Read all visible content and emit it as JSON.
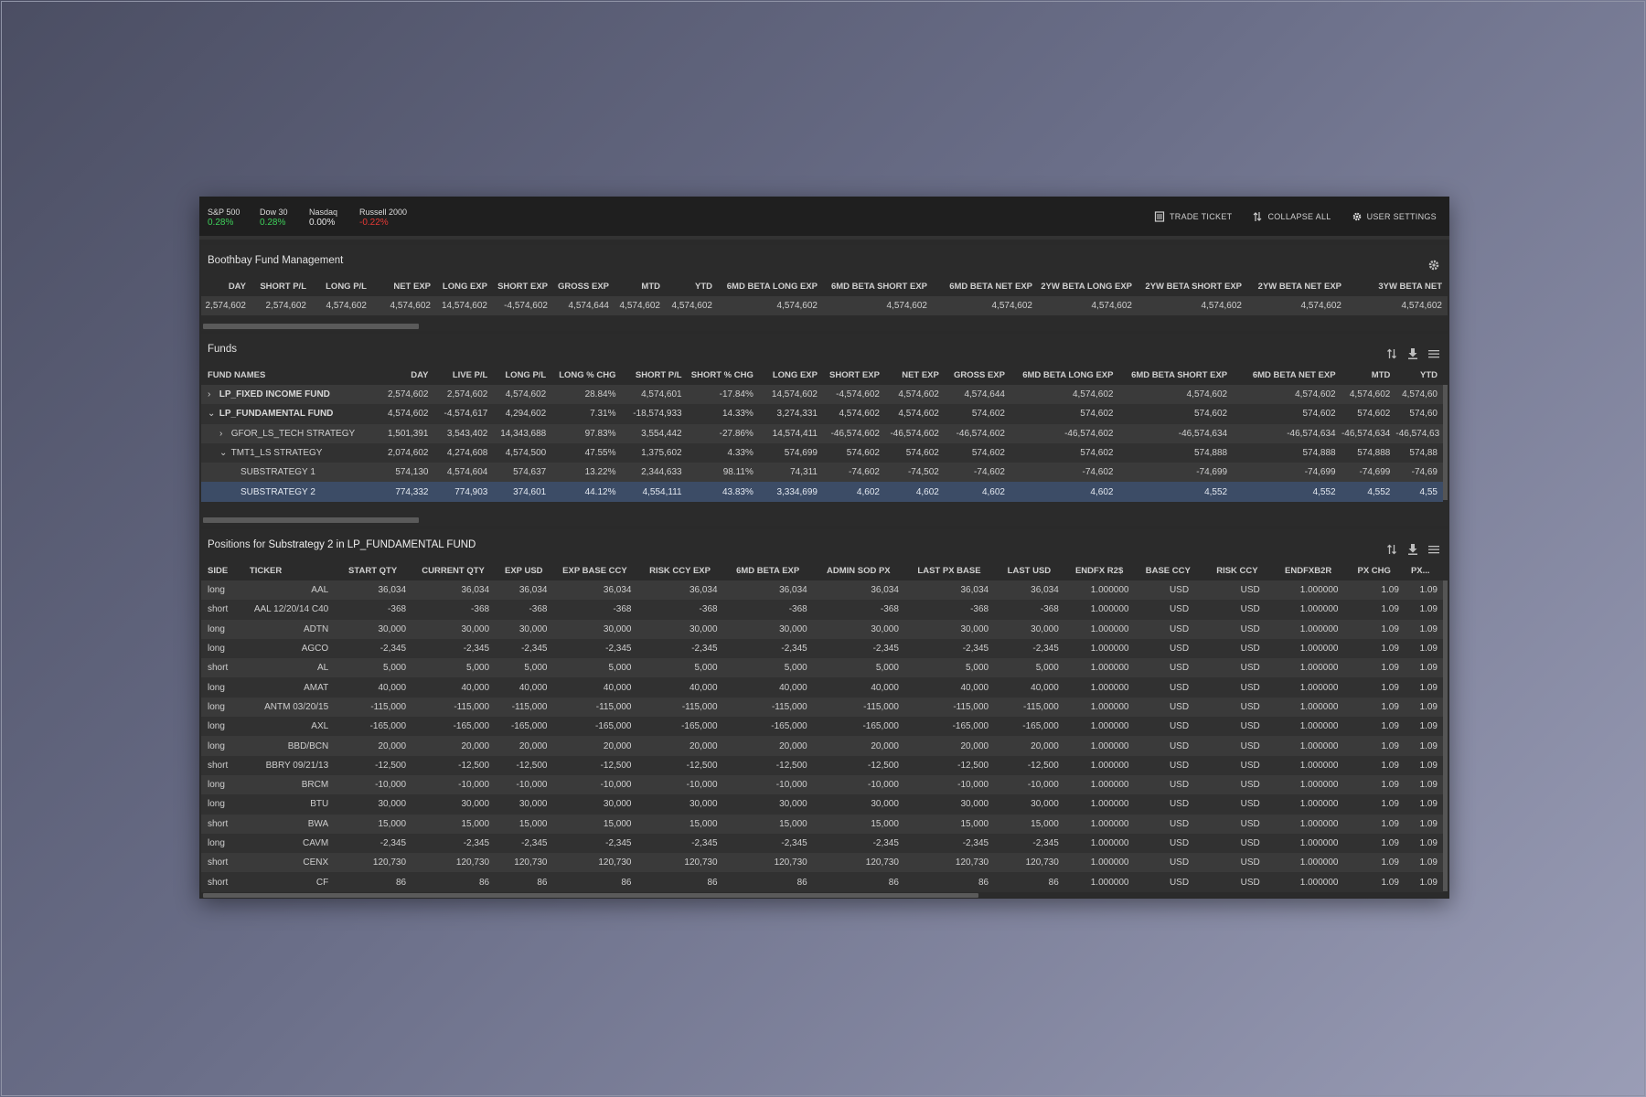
{
  "tickers": [
    {
      "name": "S&P 500",
      "value": "0.28%",
      "tone": "pos"
    },
    {
      "name": "Dow 30",
      "value": "0.28%",
      "tone": "pos"
    },
    {
      "name": "Nasdaq",
      "value": "0.00%",
      "tone": "neu"
    },
    {
      "name": "Russell 2000",
      "value": "-0.22%",
      "tone": "neg"
    }
  ],
  "actions": {
    "trade_ticket": "TRADE TICKET",
    "collapse_all": "COLLAPSE ALL",
    "user_settings": "USER SETTINGS"
  },
  "summary": {
    "title": "Boothbay Fund Management",
    "columns": [
      "DAY",
      "SHORT P/L",
      "LONG P/L",
      "NET EXP",
      "LONG EXP",
      "SHORT EXP",
      "GROSS EXP",
      "MTD",
      "YTD",
      "6MD BETA LONG EXP",
      "6MD BETA SHORT EXP",
      "6MD BETA NET EXP",
      "2YW BETA LONG EXP",
      "2YW BETA SHORT EXP",
      "2YW BETA NET EXP",
      "3YW BETA NET"
    ],
    "row": [
      "2,574,602",
      "2,574,602",
      "4,574,602",
      "4,574,602",
      "14,574,602",
      "-4,574,602",
      "4,574,644",
      "4,574,602",
      "4,574,602",
      "4,574,602",
      "4,574,602",
      "4,574,602",
      "4,574,602",
      "4,574,602",
      "4,574,602",
      "4,574,602"
    ]
  },
  "funds": {
    "title": "Funds",
    "columns": [
      "FUND NAMES",
      "DAY",
      "LIVE P/L",
      "LONG P/L",
      "LONG % CHG",
      "SHORT P/L",
      "SHORT % CHG",
      "LONG EXP",
      "SHORT EXP",
      "NET EXP",
      "GROSS EXP",
      "6MD BETA LONG EXP",
      "6MD BETA SHORT EXP",
      "6MD BETA NET EXP",
      "MTD",
      "YTD"
    ],
    "rows": [
      {
        "name": "LP_FIXED INCOME FUND",
        "level": 0,
        "toggle": "›",
        "bold": true,
        "values": [
          "2,574,602",
          "2,574,602",
          "4,574,602",
          "28.84%",
          "4,574,601",
          "-17.84%",
          "14,574,602",
          "-4,574,602",
          "4,574,602",
          "4,574,644",
          "4,574,602",
          "4,574,602",
          "4,574,602",
          "4,574,602",
          "4,574,60"
        ]
      },
      {
        "name": "LP_FUNDAMENTAL FUND",
        "level": 0,
        "toggle": "⌄",
        "bold": true,
        "values": [
          "4,574,602",
          "-4,574,617",
          "4,294,602",
          "7.31%",
          "-18,574,933",
          "14.33%",
          "3,274,331",
          "4,574,602",
          "4,574,602",
          "574,602",
          "574,602",
          "574,602",
          "574,602",
          "574,602",
          "574,60"
        ]
      },
      {
        "name": "GFOR_LS_TECH STRATEGY",
        "level": 1,
        "toggle": "›",
        "bold": false,
        "values": [
          "1,501,391",
          "3,543,402",
          "14,343,688",
          "97.83%",
          "3,554,442",
          "-27.86%",
          "14,574,411",
          "-46,574,602",
          "-46,574,602",
          "-46,574,602",
          "-46,574,602",
          "-46,574,634",
          "-46,574,634",
          "-46,574,634",
          "-46,574,63"
        ]
      },
      {
        "name": "TMT1_LS STRATEGY",
        "level": 1,
        "toggle": "⌄",
        "bold": false,
        "values": [
          "2,074,602",
          "4,274,608",
          "4,574,500",
          "47.55%",
          "1,375,602",
          "4.33%",
          "574,699",
          "574,602",
          "574,602",
          "574,602",
          "574,602",
          "574,888",
          "574,888",
          "574,888",
          "574,88"
        ]
      },
      {
        "name": "SUBSTRATEGY 1",
        "level": 2,
        "toggle": "",
        "bold": false,
        "values": [
          "574,130",
          "4,574,604",
          "574,637",
          "13.22%",
          "2,344,633",
          "98.11%",
          "74,311",
          "-74,602",
          "-74,502",
          "-74,602",
          "-74,602",
          "-74,699",
          "-74,699",
          "-74,699",
          "-74,69"
        ]
      },
      {
        "name": "SUBSTRATEGY 2",
        "level": 2,
        "toggle": "",
        "bold": false,
        "selected": true,
        "values": [
          "774,332",
          "774,903",
          "374,601",
          "44.12%",
          "4,554,111",
          "43.83%",
          "3,334,699",
          "4,602",
          "4,602",
          "4,602",
          "4,602",
          "4,552",
          "4,552",
          "4,552",
          "4,55"
        ]
      }
    ]
  },
  "positions": {
    "title_prefix": "Positions for ",
    "title_subject": "Substrategy 2 in LP_FUNDAMENTAL FUND",
    "columns": [
      "SIDE",
      "TICKER",
      "START QTY",
      "CURRENT QTY",
      "EXP USD",
      "EXP BASE CCY",
      "RISK CCY EXP",
      "6MD BETA EXP",
      "ADMIN SOD PX",
      "LAST PX BASE",
      "LAST USD",
      "ENDFX R2$",
      "BASE CCY",
      "RISK CCY",
      "ENDFXB2R",
      "PX CHG",
      "PX..."
    ],
    "rows": [
      [
        "long",
        "AAL",
        "36,034",
        "36,034",
        "36,034",
        "36,034",
        "36,034",
        "36,034",
        "36,034",
        "36,034",
        "36,034",
        "1.000000",
        "USD",
        "USD",
        "1.000000",
        "1.09",
        "1.09"
      ],
      [
        "short",
        "AAL 12/20/14 C40",
        "-368",
        "-368",
        "-368",
        "-368",
        "-368",
        "-368",
        "-368",
        "-368",
        "-368",
        "1.000000",
        "USD",
        "USD",
        "1.000000",
        "1.09",
        "1.09"
      ],
      [
        "long",
        "ADTN",
        "30,000",
        "30,000",
        "30,000",
        "30,000",
        "30,000",
        "30,000",
        "30,000",
        "30,000",
        "30,000",
        "1.000000",
        "USD",
        "USD",
        "1.000000",
        "1.09",
        "1.09"
      ],
      [
        "long",
        "AGCO",
        "-2,345",
        "-2,345",
        "-2,345",
        "-2,345",
        "-2,345",
        "-2,345",
        "-2,345",
        "-2,345",
        "-2,345",
        "1.000000",
        "USD",
        "USD",
        "1.000000",
        "1.09",
        "1.09"
      ],
      [
        "short",
        "AL",
        "5,000",
        "5,000",
        "5,000",
        "5,000",
        "5,000",
        "5,000",
        "5,000",
        "5,000",
        "5,000",
        "1.000000",
        "USD",
        "USD",
        "1.000000",
        "1.09",
        "1.09"
      ],
      [
        "long",
        "AMAT",
        "40,000",
        "40,000",
        "40,000",
        "40,000",
        "40,000",
        "40,000",
        "40,000",
        "40,000",
        "40,000",
        "1.000000",
        "USD",
        "USD",
        "1.000000",
        "1.09",
        "1.09"
      ],
      [
        "long",
        "ANTM 03/20/15",
        "-115,000",
        "-115,000",
        "-115,000",
        "-115,000",
        "-115,000",
        "-115,000",
        "-115,000",
        "-115,000",
        "-115,000",
        "1.000000",
        "USD",
        "USD",
        "1.000000",
        "1.09",
        "1.09"
      ],
      [
        "long",
        "AXL",
        "-165,000",
        "-165,000",
        "-165,000",
        "-165,000",
        "-165,000",
        "-165,000",
        "-165,000",
        "-165,000",
        "-165,000",
        "1.000000",
        "USD",
        "USD",
        "1.000000",
        "1.09",
        "1.09"
      ],
      [
        "long",
        "BBD/BCN",
        "20,000",
        "20,000",
        "20,000",
        "20,000",
        "20,000",
        "20,000",
        "20,000",
        "20,000",
        "20,000",
        "1.000000",
        "USD",
        "USD",
        "1.000000",
        "1.09",
        "1.09"
      ],
      [
        "short",
        "BBRY 09/21/13",
        "-12,500",
        "-12,500",
        "-12,500",
        "-12,500",
        "-12,500",
        "-12,500",
        "-12,500",
        "-12,500",
        "-12,500",
        "1.000000",
        "USD",
        "USD",
        "1.000000",
        "1.09",
        "1.09"
      ],
      [
        "long",
        "BRCM",
        "-10,000",
        "-10,000",
        "-10,000",
        "-10,000",
        "-10,000",
        "-10,000",
        "-10,000",
        "-10,000",
        "-10,000",
        "1.000000",
        "USD",
        "USD",
        "1.000000",
        "1.09",
        "1.09"
      ],
      [
        "long",
        "BTU",
        "30,000",
        "30,000",
        "30,000",
        "30,000",
        "30,000",
        "30,000",
        "30,000",
        "30,000",
        "30,000",
        "1.000000",
        "USD",
        "USD",
        "1.000000",
        "1.09",
        "1.09"
      ],
      [
        "short",
        "BWA",
        "15,000",
        "15,000",
        "15,000",
        "15,000",
        "15,000",
        "15,000",
        "15,000",
        "15,000",
        "15,000",
        "1.000000",
        "USD",
        "USD",
        "1.000000",
        "1.09",
        "1.09"
      ],
      [
        "long",
        "CAVM",
        "-2,345",
        "-2,345",
        "-2,345",
        "-2,345",
        "-2,345",
        "-2,345",
        "-2,345",
        "-2,345",
        "-2,345",
        "1.000000",
        "USD",
        "USD",
        "1.000000",
        "1.09",
        "1.09"
      ],
      [
        "short",
        "CENX",
        "120,730",
        "120,730",
        "120,730",
        "120,730",
        "120,730",
        "120,730",
        "120,730",
        "120,730",
        "120,730",
        "1.000000",
        "USD",
        "USD",
        "1.000000",
        "1.09",
        "1.09"
      ],
      [
        "short",
        "CF",
        "86",
        "86",
        "86",
        "86",
        "86",
        "86",
        "86",
        "86",
        "86",
        "1.000000",
        "USD",
        "USD",
        "1.000000",
        "1.09",
        "1.09"
      ]
    ]
  },
  "icons": {
    "trade_ticket": "ticket-icon",
    "collapse_all": "collapse-icon",
    "user_settings": "gear-icon",
    "panel_sort": "sort-icon",
    "panel_download": "download-icon",
    "panel_menu": "menu-icon"
  },
  "colors": {
    "positive": "#3ecf5a",
    "negative": "#e53935",
    "selected_row": "#3c4c66"
  }
}
